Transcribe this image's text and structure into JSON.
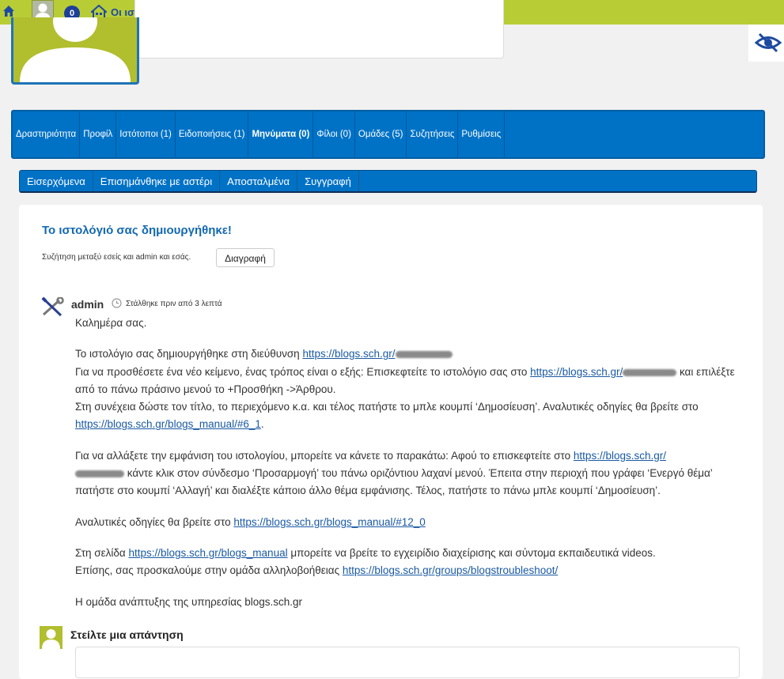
{
  "adminbar": {
    "notification_count": "0",
    "my_sites_label": "Οι ιστότοποι μου"
  },
  "main_nav": {
    "items": [
      {
        "label": "Δραστηριότητα"
      },
      {
        "label": "Προφίλ"
      },
      {
        "label": "Ιστότοποι (1)"
      },
      {
        "label": "Ειδοποιήσεις (1)"
      },
      {
        "label": "Μηνύματα (0)"
      },
      {
        "label": "Φίλοι (0)"
      },
      {
        "label": "Ομάδες (5)"
      },
      {
        "label": "Συζητήσεις"
      },
      {
        "label": "Ρυθμίσεις"
      }
    ]
  },
  "sub_nav": {
    "items": [
      {
        "label": "Εισερχόμενα"
      },
      {
        "label": "Επισημάνθηκε με αστέρι"
      },
      {
        "label": "Αποσταλμένα"
      },
      {
        "label": "Συγγραφή"
      }
    ]
  },
  "thread": {
    "title": "Το ιστολόγιό σας δημιουργήθηκε!",
    "meta": "Συζήτηση μεταξύ εσείς και admin και εσάς.",
    "delete_label": "Διαγραφή"
  },
  "message": {
    "author": "admin",
    "time": "Στάλθηκε πριν από 3 λεπτά",
    "greeting": "Καλημέρα σας.",
    "p1_a": "Το ιστολόγιο σας δημιουργήθηκε στη διεύθυνση ",
    "p1_link": "https://blogs.sch.gr/",
    "p1_b": "Για να προσθέσετε ένα νέο κείμενο, ένας τρόπος είναι ο εξής: Επισκεφτείτε το ιστολόγιο σας στο ",
    "p1_link2": "https://blogs.sch.gr/",
    "p1_c": " και επιλέξτε από το πάνω πράσινο μενού το +Προσθήκη ->Άρθρου.",
    "p1_d": "Στη συνέχεια δώστε τον τίτλο, το περιεχόμενο κ.α. και τέλος πατήστε το μπλε κουμπί ‘Δημοσίευση’. Αναλυτικές οδηγίες θα βρείτε στο ",
    "p1_link3": "https://blogs.sch.gr/blogs_manual/#6_1",
    "p1_e": ".",
    "p2_a": "Για να αλλάξετε την εμφάνιση του ιστολογίου, μπορείτε να κάνετε το παρακάτω: Αφού το επισκεφτείτε στο ",
    "p2_link": "https://blogs.sch.gr/",
    "p2_b": " κάντε κλικ στον σύνδεσμο ‘Προσαρμογή’ του πάνω οριζόντιου λαχανί μενού. Έπειτα στην περιοχή που γράφει ‘Ενεργό θέμα’ πατήστε στο κουμπί ‘Αλλαγή’ και διαλέξτε κάποιο άλλο θέμα εμφάνισης. Τέλος, πατήστε το πάνω μπλε κουμπί ‘Δημοσίευση’.",
    "p3_a": "Αναλυτικές οδηγίες θα βρείτε στο ",
    "p3_link": "https://blogs.sch.gr/blogs_manual/#12_0",
    "p4_a": "Στη σελίδα ",
    "p4_link": "https://blogs.sch.gr/blogs_manual",
    "p4_b": " μπορείτε να βρείτε το εγχειρίδιο διαχείρισης και σύντομα εκπαιδευτικά videos.",
    "p4_c": "Επίσης, σας προσκαλούμε στην ομάδα αλληλοβοήθειας ",
    "p4_link2": "https://blogs.sch.gr/groups/blogstroubleshoot/",
    "p5": "Η ομάδα ανάπτυξης της υπηρεσίας blogs.sch.gr"
  },
  "reply": {
    "title": "Στείλτε μια απάντηση"
  },
  "colors": {
    "adminbar": "#b8cc36",
    "nav": "#0072c6",
    "link": "#1a5aa3"
  }
}
